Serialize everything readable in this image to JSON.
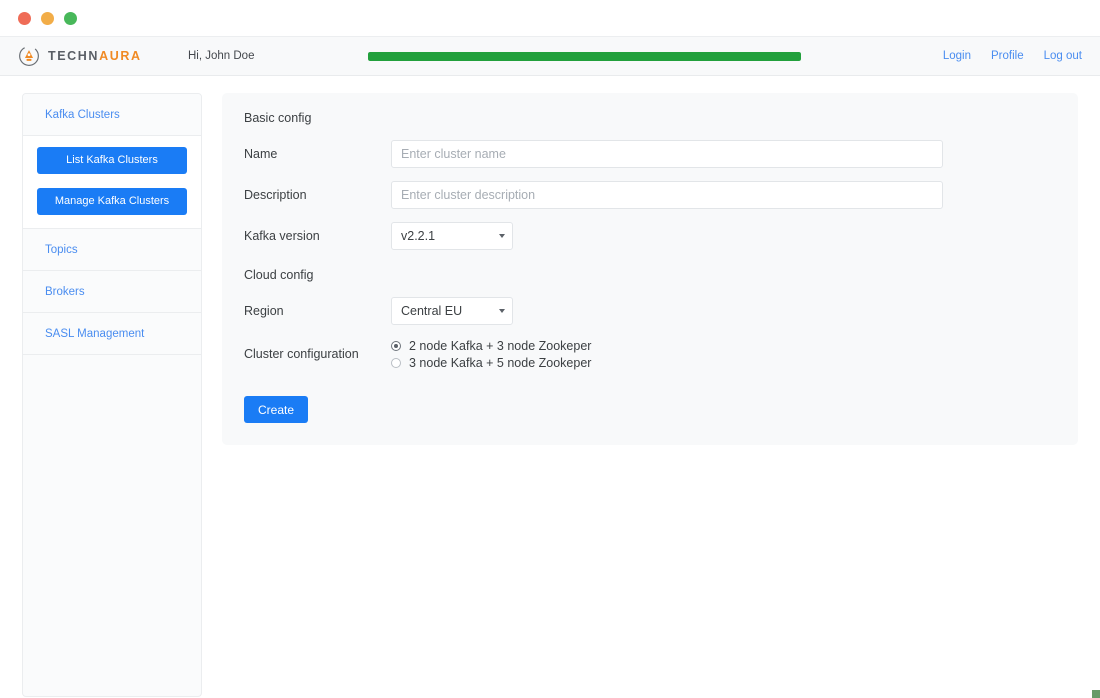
{
  "window": {
    "dots": [
      "close-red",
      "minimize-yellow",
      "maximize-green"
    ]
  },
  "header": {
    "brand": {
      "icon": "technaura-circle-logo-icon",
      "text_primary": "TECHN",
      "text_accent": "AURA"
    },
    "greeting": "Hi, John Doe",
    "progress": {
      "value": 100,
      "color": "#22a03c"
    },
    "nav": [
      {
        "label": "Login"
      },
      {
        "label": "Profile"
      },
      {
        "label": "Log out"
      }
    ]
  },
  "sidebar": {
    "items": [
      {
        "label": "Kafka Clusters"
      },
      {
        "label": "Topics"
      },
      {
        "label": "Brokers"
      },
      {
        "label": "SASL Management"
      }
    ],
    "buttons": [
      {
        "label": "List Kafka Clusters"
      },
      {
        "label": "Manage Kafka Clusters"
      }
    ]
  },
  "main": {
    "basic_config_title": "Basic config",
    "cloud_config_title": "Cloud config",
    "fields": {
      "name": {
        "label": "Name",
        "placeholder": "Enter cluster name",
        "value": ""
      },
      "description": {
        "label": "Description",
        "placeholder": "Enter cluster description",
        "value": ""
      },
      "kafka_version": {
        "label": "Kafka version",
        "selected": "v2.2.1",
        "options": [
          "v2.2.1"
        ]
      },
      "region": {
        "label": "Region",
        "selected": "Central EU",
        "options": [
          "Central EU"
        ]
      },
      "cluster_configuration": {
        "label": "Cluster configuration",
        "options": [
          {
            "label": "2 node Kafka + 3 node Zookeper",
            "selected": true
          },
          {
            "label": "3 node Kafka + 5 node Zookeper",
            "selected": false
          }
        ]
      }
    },
    "create_button": "Create"
  },
  "colors": {
    "accent_blue": "#1a7cf5",
    "link_blue": "#4a8df0",
    "brand_orange": "#f08a24",
    "progress_green": "#22a03c"
  }
}
